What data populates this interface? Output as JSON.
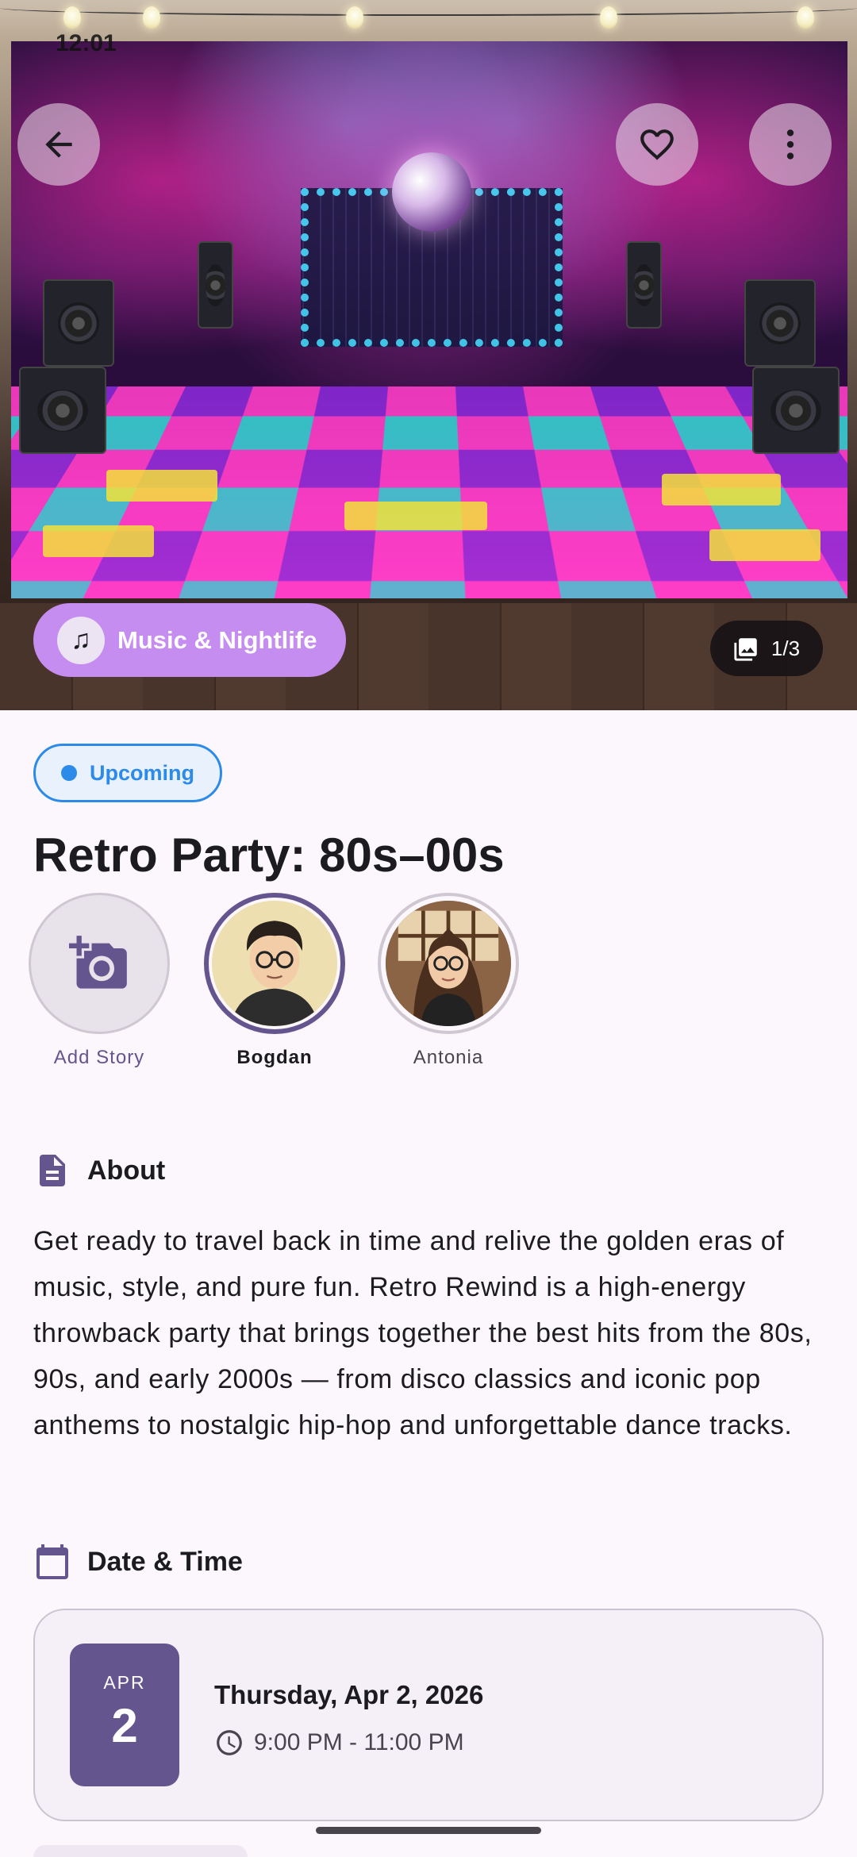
{
  "status_bar": {
    "time": "12:01"
  },
  "hero": {
    "category": "Music & Nightlife",
    "category_icon": "music-notes-icon",
    "image_counter": "1/3"
  },
  "event": {
    "status": "Upcoming",
    "title": "Retro Party: 80s–00s"
  },
  "stories": {
    "add_label": "Add Story",
    "items": [
      {
        "name": "Bogdan"
      },
      {
        "name": "Antonia"
      }
    ]
  },
  "about": {
    "heading": "About",
    "text": "Get ready to travel back in time and relive the golden eras of music, style, and pure fun. Retro Rewind is a high-energy throwback party that brings together the best hits from the 80s, 90s, and early 2000s — from disco classics and iconic pop anthems to nostalgic hip-hop and unforgettable dance tracks."
  },
  "date_time": {
    "heading": "Date & Time",
    "month": "APR",
    "day": "2",
    "date_full": "Thursday, Apr 2, 2026",
    "time_range": "9:00 PM - 11:00 PM"
  },
  "colors": {
    "accent": "#65558f",
    "category_chip": "#c68df0",
    "status_blue": "#2c8be8",
    "background": "#fbf7fc"
  }
}
